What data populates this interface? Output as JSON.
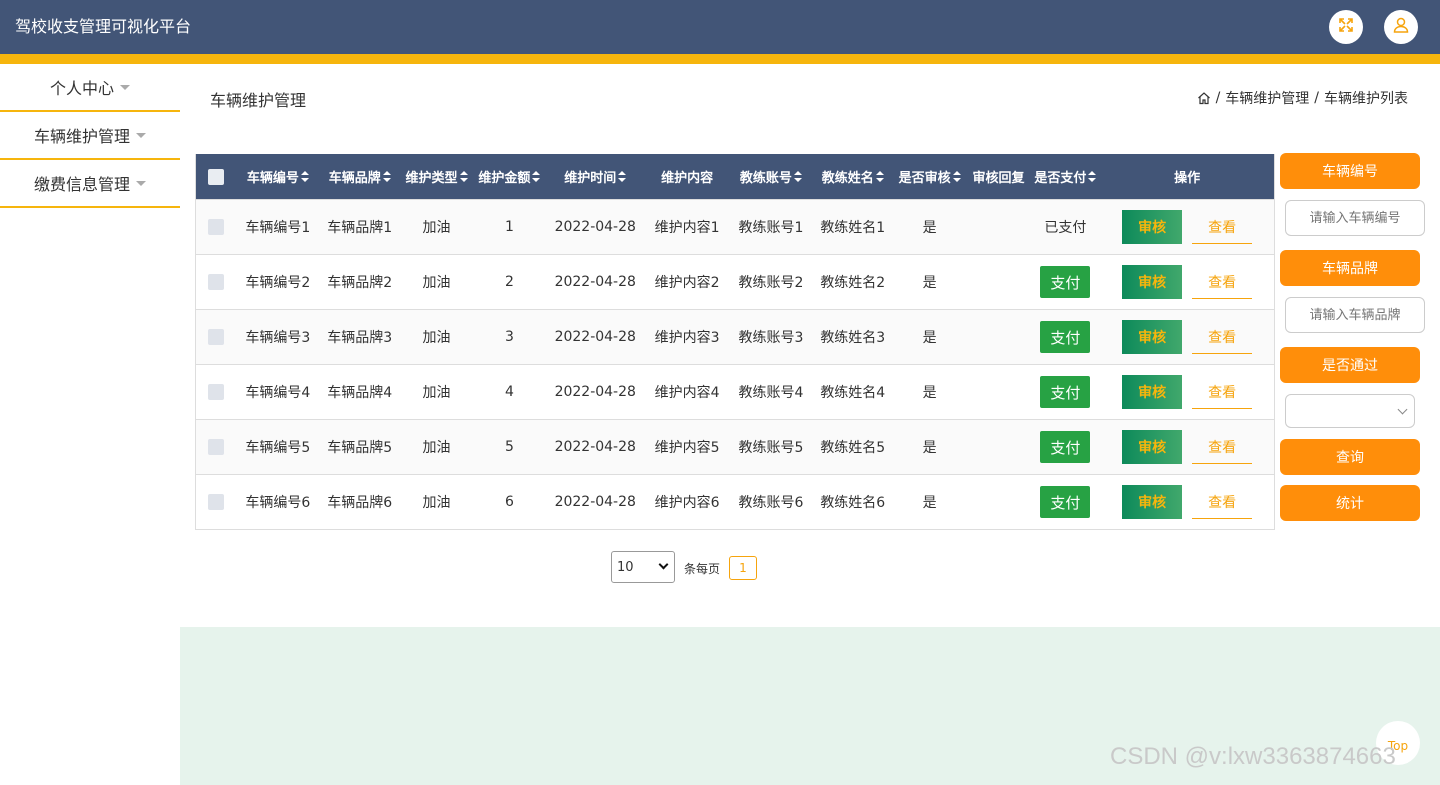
{
  "app": {
    "title": "驾校收支管理可视化平台"
  },
  "header": {
    "icons": [
      "fullscreen-icon",
      "user-icon"
    ]
  },
  "sidebar": {
    "items": [
      {
        "label": "个人中心"
      },
      {
        "label": "车辆维护管理"
      },
      {
        "label": "缴费信息管理"
      }
    ]
  },
  "page": {
    "title": "车辆维护管理"
  },
  "breadcrumb": {
    "items": [
      "车辆维护管理",
      "车辆维护列表"
    ],
    "sep": "/"
  },
  "table": {
    "headers": [
      "车辆编号",
      "车辆品牌",
      "维护类型",
      "维护金额",
      "维护时间",
      "维护内容",
      "教练账号",
      "教练姓名",
      "是否审核",
      "审核回复",
      "是否支付",
      "操作"
    ],
    "rows": [
      {
        "vehicle_no": "车辆编号1",
        "brand": "车辆品牌1",
        "type": "加油",
        "amount": "1",
        "time": "2022-04-28",
        "content": "维护内容1",
        "coach_account": "教练账号1",
        "coach_name": "教练姓名1",
        "audited": "是",
        "reply": "",
        "paid": "已支付"
      },
      {
        "vehicle_no": "车辆编号2",
        "brand": "车辆品牌2",
        "type": "加油",
        "amount": "2",
        "time": "2022-04-28",
        "content": "维护内容2",
        "coach_account": "教练账号2",
        "coach_name": "教练姓名2",
        "audited": "是",
        "reply": "",
        "paid": ""
      },
      {
        "vehicle_no": "车辆编号3",
        "brand": "车辆品牌3",
        "type": "加油",
        "amount": "3",
        "time": "2022-04-28",
        "content": "维护内容3",
        "coach_account": "教练账号3",
        "coach_name": "教练姓名3",
        "audited": "是",
        "reply": "",
        "paid": ""
      },
      {
        "vehicle_no": "车辆编号4",
        "brand": "车辆品牌4",
        "type": "加油",
        "amount": "4",
        "time": "2022-04-28",
        "content": "维护内容4",
        "coach_account": "教练账号4",
        "coach_name": "教练姓名4",
        "audited": "是",
        "reply": "",
        "paid": ""
      },
      {
        "vehicle_no": "车辆编号5",
        "brand": "车辆品牌5",
        "type": "加油",
        "amount": "5",
        "time": "2022-04-28",
        "content": "维护内容5",
        "coach_account": "教练账号5",
        "coach_name": "教练姓名5",
        "audited": "是",
        "reply": "",
        "paid": ""
      },
      {
        "vehicle_no": "车辆编号6",
        "brand": "车辆品牌6",
        "type": "加油",
        "amount": "6",
        "time": "2022-04-28",
        "content": "维护内容6",
        "coach_account": "教练账号6",
        "coach_name": "教练姓名6",
        "audited": "是",
        "reply": "",
        "paid": ""
      }
    ],
    "actions": {
      "pay": "支付",
      "audit": "审核",
      "view": "查看"
    }
  },
  "search": {
    "vehicle_no_label": "车辆编号",
    "vehicle_no_placeholder": "请输入车辆编号",
    "brand_label": "车辆品牌",
    "brand_placeholder": "请输入车辆品牌",
    "passed_label": "是否通过",
    "passed_value": "",
    "query_button": "查询",
    "stats_button": "统计"
  },
  "pagination": {
    "page_size": "10",
    "per_page_label": "条每页",
    "current_page": "1"
  },
  "footer": {
    "top_button": "Top"
  },
  "watermark": "CSDN @v:lxw3363874663",
  "colors": {
    "header": "#425577",
    "accent": "#f6b50d",
    "orange_button": "#ff8e0a",
    "pay_green": "#27a244",
    "footer_bg": "#e6f3ec"
  }
}
